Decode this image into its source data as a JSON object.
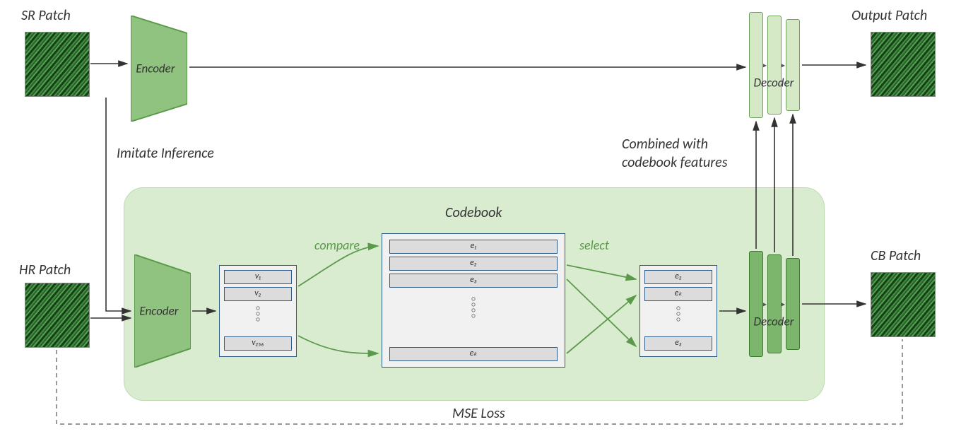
{
  "labels": {
    "sr_patch": "SR Patch",
    "hr_patch": "HR Patch",
    "output_patch": "Output Patch",
    "cb_patch": "CB Patch",
    "encoder": "Encoder",
    "decoder": "Decoder",
    "imitate_inference": "Imitate Inference",
    "codebook": "Codebook",
    "compare": "compare",
    "select": "select",
    "combined_l1": "Combined with",
    "combined_l2": "codebook features",
    "mse_loss": "MSE Loss"
  },
  "vectors": {
    "v1": "v₁",
    "v2": "v₂",
    "v256": "v₂₅₆"
  },
  "codebook": {
    "e1": "e₁",
    "e2": "e₂",
    "e3": "e₃",
    "ek": "eₖ"
  },
  "selected": {
    "s1": "e₂",
    "s2": "eₖ",
    "s3": "e₃"
  }
}
